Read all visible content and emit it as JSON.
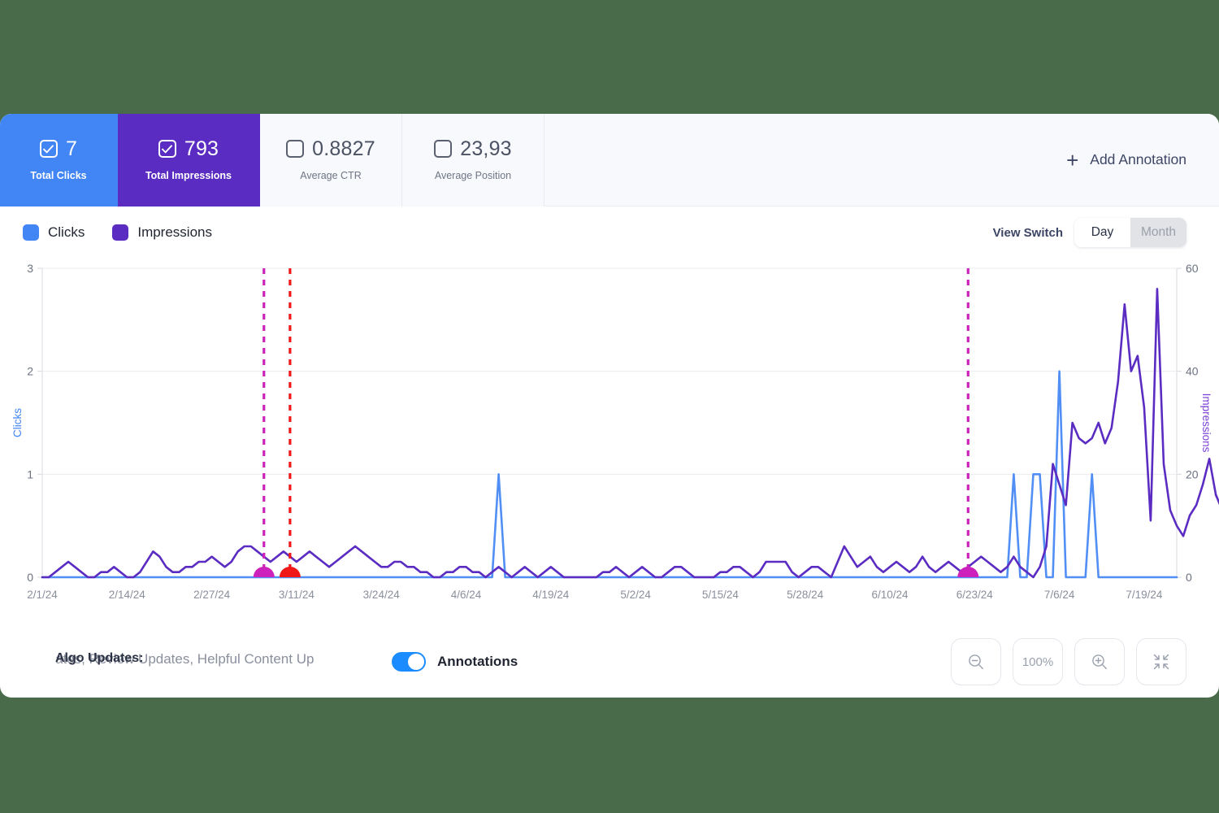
{
  "theme": {
    "page_background": "#4a6b4a",
    "clicks_color": "#4285f4",
    "impressions_color": "#5b2cc2",
    "annotation_red": "#f01818",
    "annotation_magenta": "#cc22bb"
  },
  "metrics": [
    {
      "value": "7",
      "label": "Total Clicks",
      "checked": true,
      "state": "active-blue"
    },
    {
      "value": "793",
      "label": "Total Impressions",
      "checked": true,
      "state": "active-purple"
    },
    {
      "value": "0.8827",
      "label": "Average CTR",
      "checked": false,
      "state": ""
    },
    {
      "value": "23,93",
      "label": "Average Position",
      "checked": false,
      "state": ""
    }
  ],
  "header": {
    "add_annotation_label": "Add Annotation",
    "add_annotation_icon": "plus-icon"
  },
  "legend": [
    {
      "label": "Clicks",
      "color": "#4285f4"
    },
    {
      "label": "Impressions",
      "color": "#5b2cc2"
    }
  ],
  "view_switch": {
    "label": "View Switch",
    "options": [
      {
        "label": "Day",
        "selected": true
      },
      {
        "label": "Month",
        "selected": false
      }
    ]
  },
  "bottom_bar": {
    "annotation_title": "Algo Updates:",
    "annotation_description": "ates, Review Updates, Helpful Content Up",
    "toggle_label": "Annotations",
    "toggle_on": true,
    "zoom_out_icon": "zoom-out-icon",
    "zoom_level": "100%",
    "zoom_in_icon": "zoom-in-icon",
    "fit_icon": "fit-screen-icon"
  },
  "chart_data": {
    "type": "line",
    "title": "",
    "xlabel": "",
    "ylabel": "Clicks",
    "y2label": "Impressions",
    "ylim": [
      0,
      3
    ],
    "y2lim": [
      0,
      60
    ],
    "yticks": [
      "0",
      "1",
      "2",
      "3"
    ],
    "y2ticks": [
      "0",
      "20",
      "40",
      "60"
    ],
    "grid": true,
    "legend_position": "top-left",
    "xtick_labels": [
      "2/1/24",
      "2/14/24",
      "2/27/24",
      "3/11/24",
      "3/24/24",
      "4/6/24",
      "4/19/24",
      "5/2/24",
      "5/15/24",
      "5/28/24",
      "6/10/24",
      "6/23/24",
      "7/6/24",
      "7/19/24"
    ],
    "x_start": "2/1/24",
    "x_end": "7/24/24",
    "n_points": 175,
    "series": [
      {
        "name": "Clicks",
        "axis": "left",
        "color": "#4285f4",
        "values": [
          0,
          0,
          0,
          0,
          0,
          0,
          0,
          0,
          0,
          0,
          0,
          0,
          0,
          0,
          0,
          0,
          0,
          0,
          0,
          0,
          0,
          0,
          0,
          0,
          0,
          0,
          0,
          0,
          0,
          0,
          0,
          0,
          0,
          0,
          0,
          0,
          0,
          0,
          0,
          0,
          0,
          0,
          0,
          0,
          0,
          0,
          0,
          0,
          0,
          0,
          0,
          0,
          0,
          0,
          0,
          0,
          0,
          0,
          0,
          0,
          0,
          0,
          0,
          0,
          0,
          0,
          0,
          0,
          0,
          0,
          1,
          0,
          0,
          0,
          0,
          0,
          0,
          0,
          0,
          0,
          0,
          0,
          0,
          0,
          0,
          0,
          0,
          0,
          0,
          0,
          0,
          0,
          0,
          0,
          0,
          0,
          0,
          0,
          0,
          0,
          0,
          0,
          0,
          0,
          0,
          0,
          0,
          0,
          0,
          0,
          0,
          0,
          0,
          0,
          0,
          0,
          0,
          0,
          0,
          0,
          0,
          0,
          0,
          0,
          0,
          0,
          0,
          0,
          0,
          0,
          0,
          0,
          0,
          0,
          0,
          0,
          0,
          0,
          0,
          0,
          0,
          0,
          0,
          0,
          0,
          0,
          0,
          0,
          0,
          1,
          0,
          0,
          1,
          1,
          0,
          0,
          2,
          0,
          0,
          0,
          0,
          1,
          0,
          0,
          0,
          0,
          0,
          0,
          0,
          0,
          0,
          0,
          0,
          0,
          0
        ]
      },
      {
        "name": "Impressions",
        "axis": "right",
        "color": "#5b2cc2",
        "values": [
          0,
          0,
          1,
          2,
          3,
          2,
          1,
          0,
          0,
          1,
          1,
          2,
          1,
          0,
          0,
          1,
          3,
          5,
          4,
          2,
          1,
          1,
          2,
          2,
          3,
          3,
          4,
          3,
          2,
          3,
          5,
          6,
          6,
          5,
          4,
          3,
          4,
          5,
          4,
          3,
          4,
          5,
          4,
          3,
          2,
          3,
          4,
          5,
          6,
          5,
          4,
          3,
          2,
          2,
          3,
          3,
          2,
          2,
          1,
          1,
          0,
          0,
          1,
          1,
          2,
          2,
          1,
          1,
          0,
          1,
          2,
          1,
          0,
          1,
          2,
          1,
          0,
          1,
          2,
          1,
          0,
          0,
          0,
          0,
          0,
          0,
          1,
          1,
          2,
          1,
          0,
          1,
          2,
          1,
          0,
          0,
          1,
          2,
          2,
          1,
          0,
          0,
          0,
          0,
          1,
          1,
          2,
          2,
          1,
          0,
          1,
          3,
          3,
          3,
          3,
          1,
          0,
          1,
          2,
          2,
          1,
          0,
          3,
          6,
          4,
          2,
          3,
          4,
          2,
          1,
          2,
          3,
          2,
          1,
          2,
          4,
          2,
          1,
          2,
          3,
          2,
          1,
          2,
          3,
          4,
          3,
          2,
          1,
          2,
          4,
          2,
          1,
          0,
          2,
          6,
          22,
          18,
          14,
          30,
          27,
          26,
          27,
          30,
          26,
          29,
          38,
          53,
          40,
          43,
          33,
          11,
          56,
          22,
          13,
          10,
          8,
          12,
          14,
          18,
          23,
          16,
          13
        ]
      }
    ],
    "annotations": [
      {
        "x_index": 34,
        "color": "#cc22bb",
        "style": "dashed"
      },
      {
        "x_index": 38,
        "color": "#f01818",
        "style": "dashed"
      },
      {
        "x_index": 142,
        "color": "#cc22bb",
        "style": "dashed"
      }
    ]
  }
}
